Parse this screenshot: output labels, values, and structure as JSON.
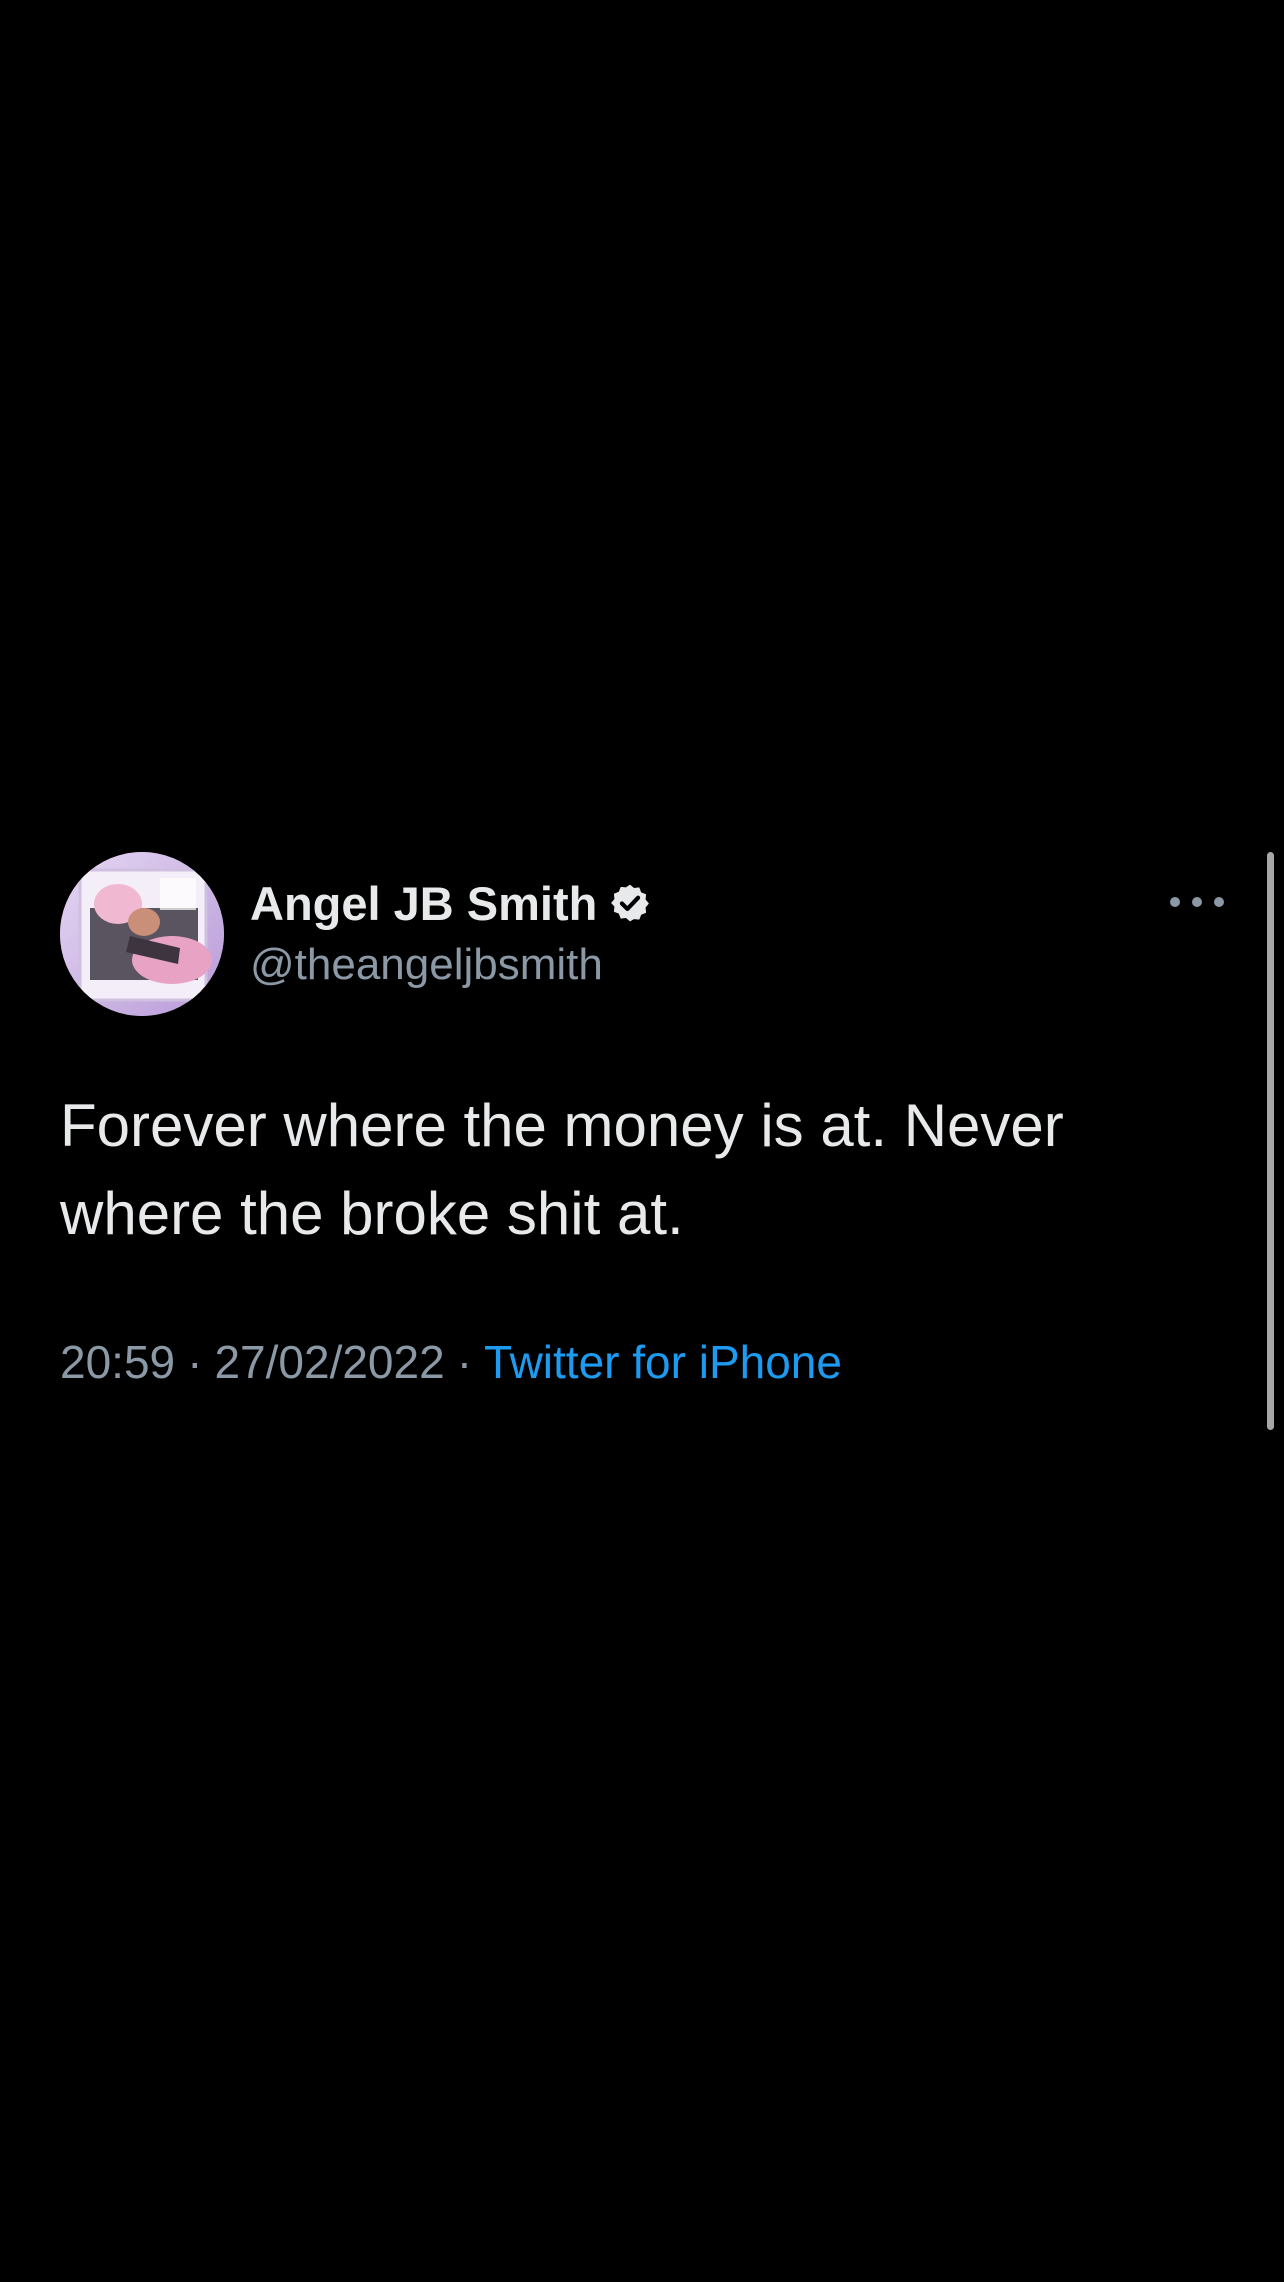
{
  "tweet": {
    "author": {
      "display_name": "Angel JB Smith",
      "handle": "@theangeljbsmith",
      "verified": true,
      "avatar_icon": "profile-photo"
    },
    "text_line_1": "Forever where the money is at. Never",
    "text_line_2": "where the broke shit at.",
    "time": "20:59",
    "date": "27/02/2022",
    "separator": "·",
    "source": "Twitter for iPhone",
    "more_icon": "more-horizontal-icon"
  },
  "colors": {
    "background": "#000000",
    "text_primary": "#e7e9ea",
    "text_secondary": "#8b98a5",
    "link": "#1d9bf0"
  }
}
